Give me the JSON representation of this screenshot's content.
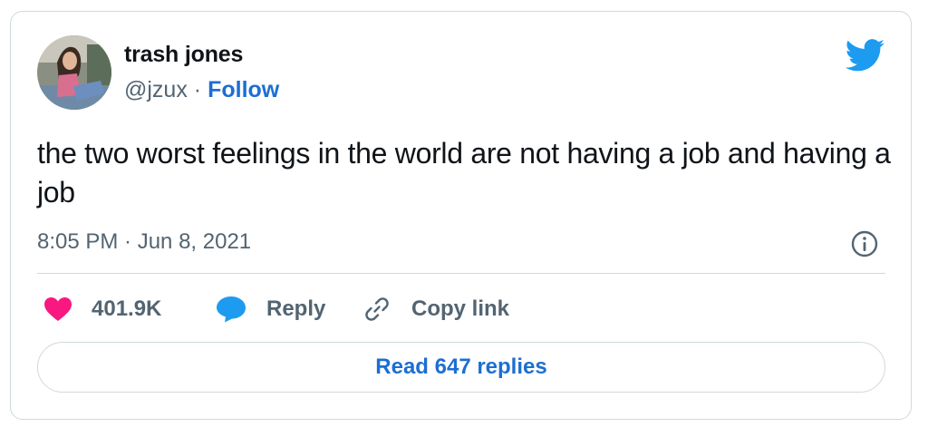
{
  "user": {
    "name": "trash jones",
    "handle": "@jzux",
    "separator": "·",
    "follow_label": "Follow"
  },
  "tweet": {
    "text": "the two worst feelings in the world are not having a job and having a job",
    "timestamp": "8:05 PM · Jun 8, 2021"
  },
  "actions": {
    "likes": "401.9K",
    "reply_label": "Reply",
    "copy_label": "Copy link"
  },
  "read_replies_label": "Read 647 replies",
  "icons": {
    "brand": "twitter-bird-icon",
    "like": "heart-icon",
    "reply": "speech-bubble-icon",
    "copy": "link-icon",
    "info": "info-icon"
  },
  "colors": {
    "accent": "#1d9bf0",
    "link": "#1d6fd1",
    "heart": "#f91880",
    "muted": "#536471",
    "border": "#cfd9de"
  }
}
